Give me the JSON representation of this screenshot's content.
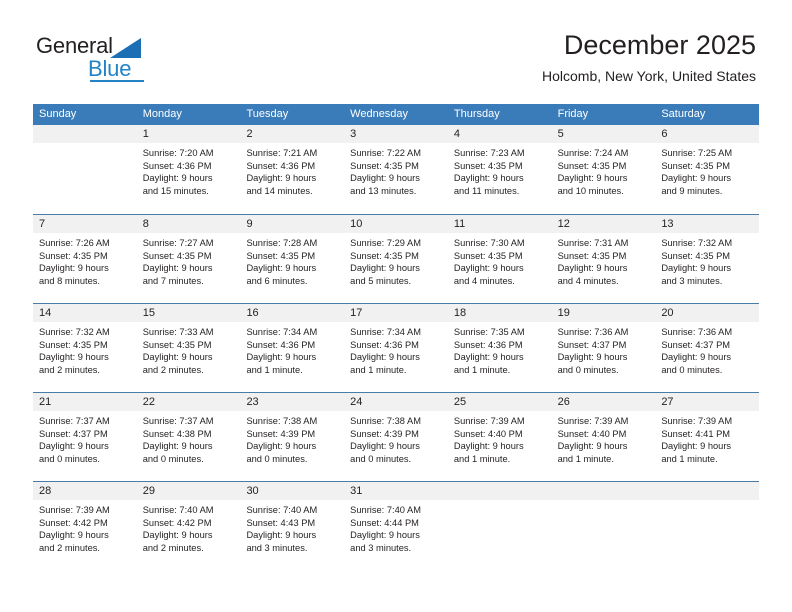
{
  "brand": {
    "name_part1": "General",
    "name_part2": "Blue",
    "triangle_color": "#1c6fb5",
    "blue_color": "#2383c6"
  },
  "header": {
    "title": "December 2025",
    "location": "Holcomb, New York, United States"
  },
  "theme": {
    "header_row_bg": "#3a7cba",
    "header_row_text": "#ffffff",
    "day_band_bg": "#f1f1f1",
    "row_divider": "#4a7ca8",
    "text": "#231f20"
  },
  "weekdays": [
    "Sunday",
    "Monday",
    "Tuesday",
    "Wednesday",
    "Thursday",
    "Friday",
    "Saturday"
  ],
  "weeks": [
    [
      {
        "day": "",
        "lines": []
      },
      {
        "day": "1",
        "lines": [
          "Sunrise: 7:20 AM",
          "Sunset: 4:36 PM",
          "Daylight: 9 hours",
          "and 15 minutes."
        ]
      },
      {
        "day": "2",
        "lines": [
          "Sunrise: 7:21 AM",
          "Sunset: 4:36 PM",
          "Daylight: 9 hours",
          "and 14 minutes."
        ]
      },
      {
        "day": "3",
        "lines": [
          "Sunrise: 7:22 AM",
          "Sunset: 4:35 PM",
          "Daylight: 9 hours",
          "and 13 minutes."
        ]
      },
      {
        "day": "4",
        "lines": [
          "Sunrise: 7:23 AM",
          "Sunset: 4:35 PM",
          "Daylight: 9 hours",
          "and 11 minutes."
        ]
      },
      {
        "day": "5",
        "lines": [
          "Sunrise: 7:24 AM",
          "Sunset: 4:35 PM",
          "Daylight: 9 hours",
          "and 10 minutes."
        ]
      },
      {
        "day": "6",
        "lines": [
          "Sunrise: 7:25 AM",
          "Sunset: 4:35 PM",
          "Daylight: 9 hours",
          "and 9 minutes."
        ]
      }
    ],
    [
      {
        "day": "7",
        "lines": [
          "Sunrise: 7:26 AM",
          "Sunset: 4:35 PM",
          "Daylight: 9 hours",
          "and 8 minutes."
        ]
      },
      {
        "day": "8",
        "lines": [
          "Sunrise: 7:27 AM",
          "Sunset: 4:35 PM",
          "Daylight: 9 hours",
          "and 7 minutes."
        ]
      },
      {
        "day": "9",
        "lines": [
          "Sunrise: 7:28 AM",
          "Sunset: 4:35 PM",
          "Daylight: 9 hours",
          "and 6 minutes."
        ]
      },
      {
        "day": "10",
        "lines": [
          "Sunrise: 7:29 AM",
          "Sunset: 4:35 PM",
          "Daylight: 9 hours",
          "and 5 minutes."
        ]
      },
      {
        "day": "11",
        "lines": [
          "Sunrise: 7:30 AM",
          "Sunset: 4:35 PM",
          "Daylight: 9 hours",
          "and 4 minutes."
        ]
      },
      {
        "day": "12",
        "lines": [
          "Sunrise: 7:31 AM",
          "Sunset: 4:35 PM",
          "Daylight: 9 hours",
          "and 4 minutes."
        ]
      },
      {
        "day": "13",
        "lines": [
          "Sunrise: 7:32 AM",
          "Sunset: 4:35 PM",
          "Daylight: 9 hours",
          "and 3 minutes."
        ]
      }
    ],
    [
      {
        "day": "14",
        "lines": [
          "Sunrise: 7:32 AM",
          "Sunset: 4:35 PM",
          "Daylight: 9 hours",
          "and 2 minutes."
        ]
      },
      {
        "day": "15",
        "lines": [
          "Sunrise: 7:33 AM",
          "Sunset: 4:35 PM",
          "Daylight: 9 hours",
          "and 2 minutes."
        ]
      },
      {
        "day": "16",
        "lines": [
          "Sunrise: 7:34 AM",
          "Sunset: 4:36 PM",
          "Daylight: 9 hours",
          "and 1 minute."
        ]
      },
      {
        "day": "17",
        "lines": [
          "Sunrise: 7:34 AM",
          "Sunset: 4:36 PM",
          "Daylight: 9 hours",
          "and 1 minute."
        ]
      },
      {
        "day": "18",
        "lines": [
          "Sunrise: 7:35 AM",
          "Sunset: 4:36 PM",
          "Daylight: 9 hours",
          "and 1 minute."
        ]
      },
      {
        "day": "19",
        "lines": [
          "Sunrise: 7:36 AM",
          "Sunset: 4:37 PM",
          "Daylight: 9 hours",
          "and 0 minutes."
        ]
      },
      {
        "day": "20",
        "lines": [
          "Sunrise: 7:36 AM",
          "Sunset: 4:37 PM",
          "Daylight: 9 hours",
          "and 0 minutes."
        ]
      }
    ],
    [
      {
        "day": "21",
        "lines": [
          "Sunrise: 7:37 AM",
          "Sunset: 4:37 PM",
          "Daylight: 9 hours",
          "and 0 minutes."
        ]
      },
      {
        "day": "22",
        "lines": [
          "Sunrise: 7:37 AM",
          "Sunset: 4:38 PM",
          "Daylight: 9 hours",
          "and 0 minutes."
        ]
      },
      {
        "day": "23",
        "lines": [
          "Sunrise: 7:38 AM",
          "Sunset: 4:39 PM",
          "Daylight: 9 hours",
          "and 0 minutes."
        ]
      },
      {
        "day": "24",
        "lines": [
          "Sunrise: 7:38 AM",
          "Sunset: 4:39 PM",
          "Daylight: 9 hours",
          "and 0 minutes."
        ]
      },
      {
        "day": "25",
        "lines": [
          "Sunrise: 7:39 AM",
          "Sunset: 4:40 PM",
          "Daylight: 9 hours",
          "and 1 minute."
        ]
      },
      {
        "day": "26",
        "lines": [
          "Sunrise: 7:39 AM",
          "Sunset: 4:40 PM",
          "Daylight: 9 hours",
          "and 1 minute."
        ]
      },
      {
        "day": "27",
        "lines": [
          "Sunrise: 7:39 AM",
          "Sunset: 4:41 PM",
          "Daylight: 9 hours",
          "and 1 minute."
        ]
      }
    ],
    [
      {
        "day": "28",
        "lines": [
          "Sunrise: 7:39 AM",
          "Sunset: 4:42 PM",
          "Daylight: 9 hours",
          "and 2 minutes."
        ]
      },
      {
        "day": "29",
        "lines": [
          "Sunrise: 7:40 AM",
          "Sunset: 4:42 PM",
          "Daylight: 9 hours",
          "and 2 minutes."
        ]
      },
      {
        "day": "30",
        "lines": [
          "Sunrise: 7:40 AM",
          "Sunset: 4:43 PM",
          "Daylight: 9 hours",
          "and 3 minutes."
        ]
      },
      {
        "day": "31",
        "lines": [
          "Sunrise: 7:40 AM",
          "Sunset: 4:44 PM",
          "Daylight: 9 hours",
          "and 3 minutes."
        ]
      },
      {
        "day": "",
        "lines": []
      },
      {
        "day": "",
        "lines": []
      },
      {
        "day": "",
        "lines": []
      }
    ]
  ]
}
